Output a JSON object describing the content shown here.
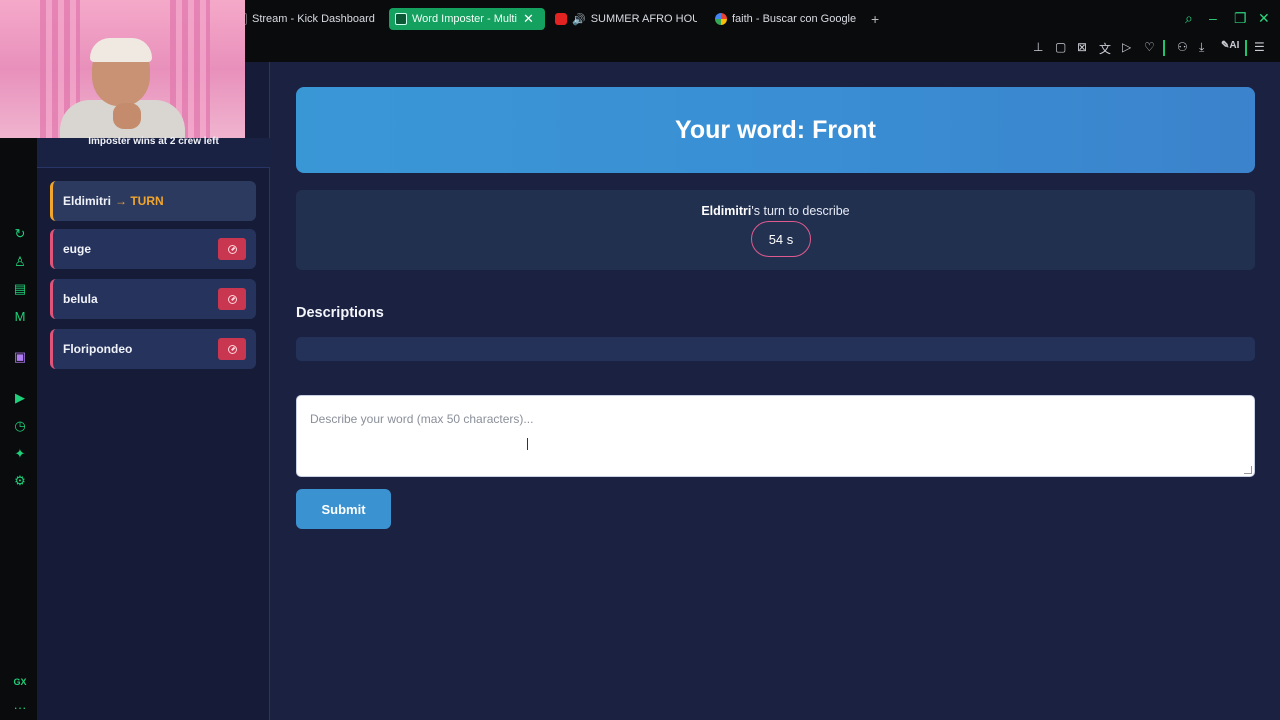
{
  "browser": {
    "tabs": [
      {
        "label": "Stream - Kick Dashboard",
        "active": false
      },
      {
        "label": "Word Imposter - Multi",
        "active": true
      },
      {
        "label": "SUMMER AFRO HOUS",
        "active": false
      },
      {
        "label": "faith - Buscar con Google",
        "active": false
      }
    ],
    "new_tab": "+",
    "close_glyph": "✕",
    "toolbar_ai": "AI",
    "sidebar_gx": "GX",
    "sidebar_more": "···"
  },
  "stream": {
    "imposter_note": "Imposter wins at 2 crew left"
  },
  "players": [
    {
      "name": "Eldimitri",
      "turn_label": "→ TURN",
      "is_turn": true
    },
    {
      "name": "euge",
      "is_turn": false
    },
    {
      "name": "belula",
      "is_turn": false
    },
    {
      "name": "Floripondeo",
      "is_turn": false
    }
  ],
  "game": {
    "word_banner": "Your word: Front",
    "turn_player": "Eldimitri",
    "turn_suffix": "'s turn to describe",
    "timer": "54 s",
    "descriptions_heading": "Descriptions",
    "input_placeholder": "Describe your word (max 50 characters)...",
    "submit_label": "Submit"
  },
  "colors": {
    "accent": "#3a92d0",
    "turn": "#f2a52c",
    "kick": "#c8374f",
    "opera_green": "#1fd07a"
  }
}
